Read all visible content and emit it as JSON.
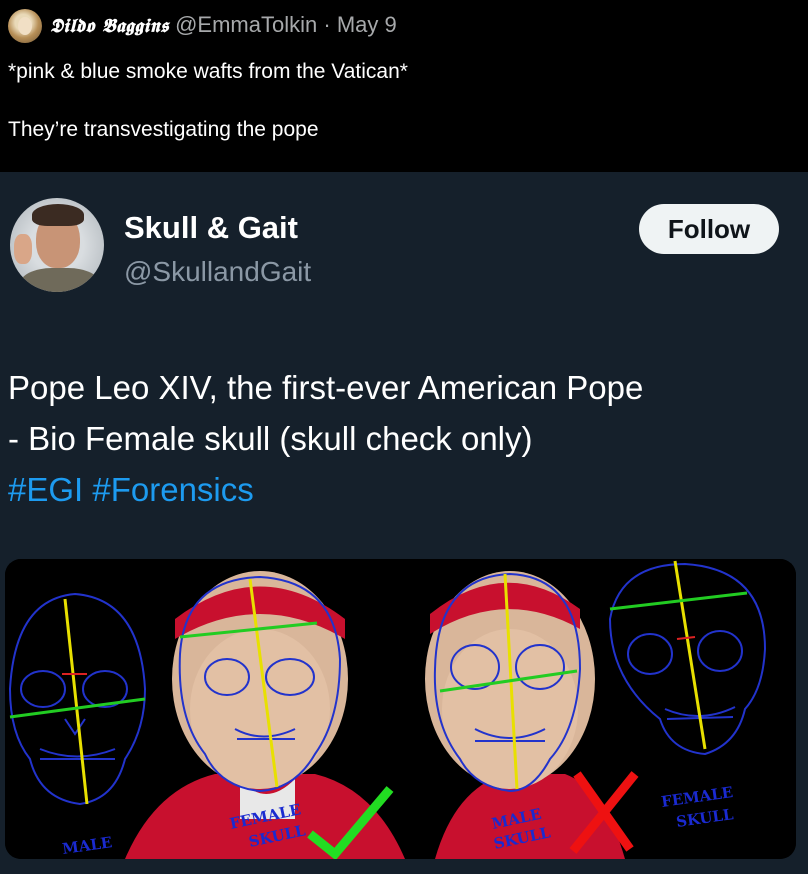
{
  "top_tweet": {
    "display_name": "𝕯𝖎𝖑𝖉𝖔 𝕭𝖆𝖌𝖌𝖎𝖓𝖘",
    "handle": "@EmmaTolkin",
    "separator": "·",
    "date": "May 9",
    "line1": "*pink & blue smoke wafts from the Vatican*",
    "line2": "They’re transvestigating the pope"
  },
  "quoted": {
    "display_name": "Skull & Gait",
    "handle": "@SkullandGait",
    "follow_label": "Follow",
    "text_line1": "Pope Leo XIV, the first-ever American Pope",
    "text_line2": "- Bio Female skull (skull check only)",
    "hashtag1": "#EGI",
    "hashtag2": "#Forensics"
  },
  "image": {
    "label_male": "MALE",
    "label_female_skull_1": "FEMALE",
    "label_female_skull_2": "SKULL",
    "label_male_skull_1": "MALE",
    "label_male_skull_2": "SKULL",
    "label_female_right_1": "FEMALE",
    "label_female_right_2": "SKULL"
  },
  "colors": {
    "bg_top": "#000000",
    "bg_card": "#15202b",
    "accent_link": "#1d9bf0",
    "follow_bg": "#eff3f4",
    "skull_line": "#2233cc",
    "check": "#22dd22",
    "cross": "#ee1111"
  }
}
